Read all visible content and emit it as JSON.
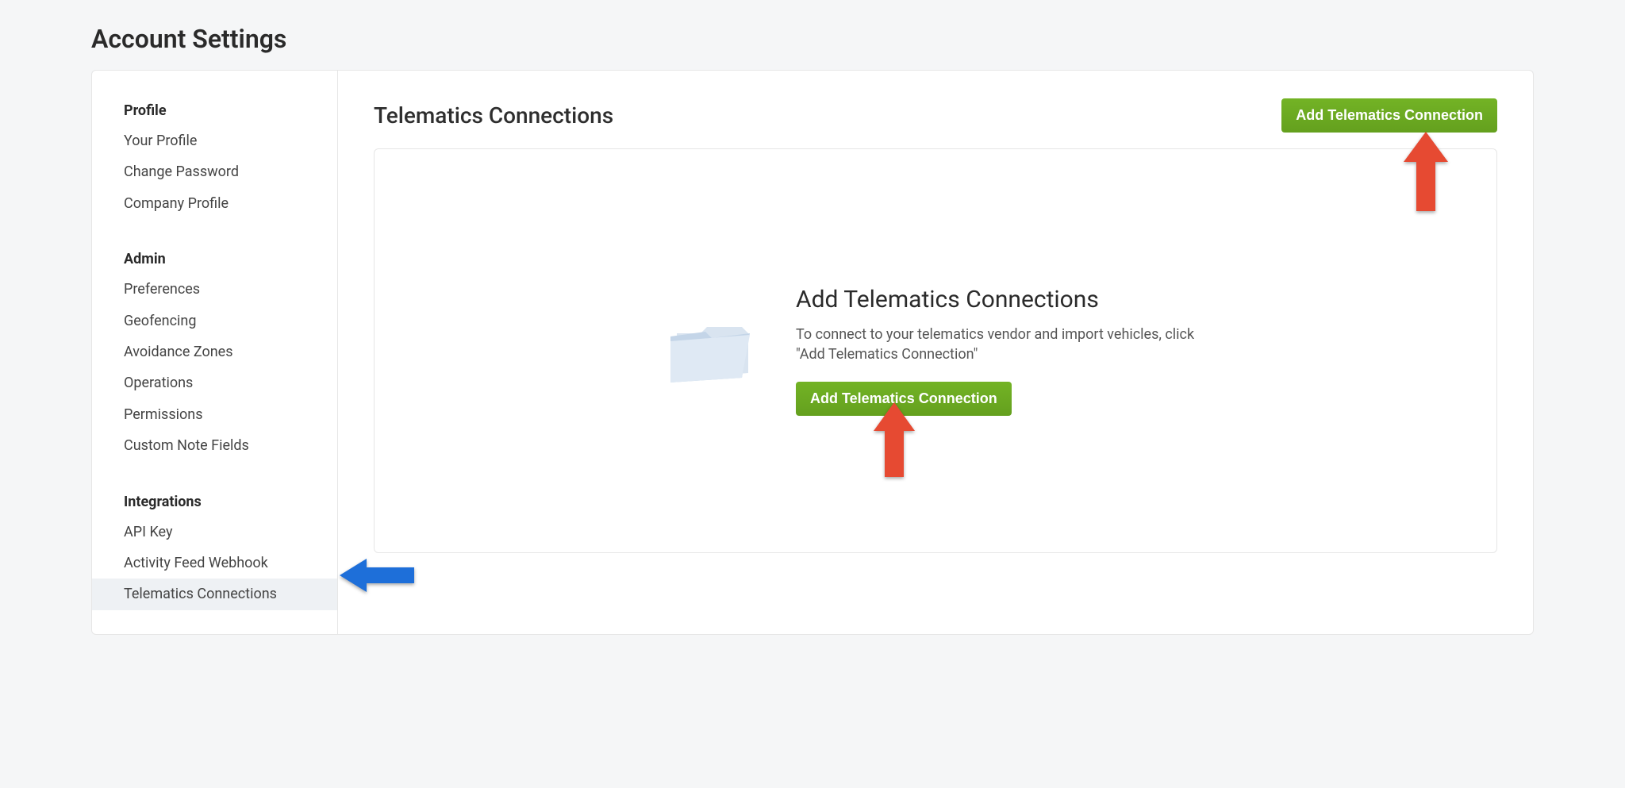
{
  "pageTitle": "Account Settings",
  "sidebar": {
    "sections": [
      {
        "header": "Profile",
        "items": [
          {
            "label": "Your Profile",
            "active": false
          },
          {
            "label": "Change Password",
            "active": false
          },
          {
            "label": "Company Profile",
            "active": false
          }
        ]
      },
      {
        "header": "Admin",
        "items": [
          {
            "label": "Preferences",
            "active": false
          },
          {
            "label": "Geofencing",
            "active": false
          },
          {
            "label": "Avoidance Zones",
            "active": false
          },
          {
            "label": "Operations",
            "active": false
          },
          {
            "label": "Permissions",
            "active": false
          },
          {
            "label": "Custom Note Fields",
            "active": false
          }
        ]
      },
      {
        "header": "Integrations",
        "items": [
          {
            "label": "API Key",
            "active": false
          },
          {
            "label": "Activity Feed Webhook",
            "active": false
          },
          {
            "label": "Telematics Connections",
            "active": true
          }
        ]
      }
    ]
  },
  "main": {
    "title": "Telematics Connections",
    "addButtonTop": "Add Telematics Connection",
    "empty": {
      "heading": "Add Telematics Connections",
      "description": "To connect to your telematics vendor and import vehicles, click \"Add Telematics Connection\"",
      "addButton": "Add Telematics Connection"
    }
  },
  "colors": {
    "primaryGreen": "#6aa721",
    "arrowRed": "#e64a32",
    "arrowBlue": "#1e6fd9"
  }
}
